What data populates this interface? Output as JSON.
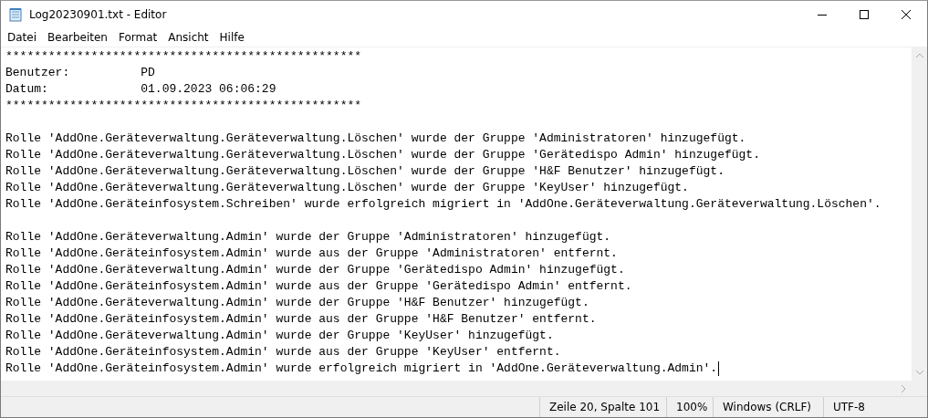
{
  "window": {
    "title": "Log20230901.txt - Editor"
  },
  "menu": [
    "Datei",
    "Bearbeiten",
    "Format",
    "Ansicht",
    "Hilfe"
  ],
  "editor": {
    "lines": [
      {
        "kind": "text",
        "text": "**************************************************"
      },
      {
        "kind": "text",
        "text": "Benutzer:          PD"
      },
      {
        "kind": "text",
        "text": "Datum:             01.09.2023 06:06:29"
      },
      {
        "kind": "text",
        "text": "**************************************************"
      },
      {
        "kind": "blank"
      },
      {
        "kind": "text",
        "text": "Rolle 'AddOne.Geräteverwaltung.Geräteverwaltung.Löschen' wurde der Gruppe 'Administratoren' hinzugefügt."
      },
      {
        "kind": "text",
        "text": "Rolle 'AddOne.Geräteverwaltung.Geräteverwaltung.Löschen' wurde der Gruppe 'Gerätedispo Admin' hinzugefügt."
      },
      {
        "kind": "text",
        "text": "Rolle 'AddOne.Geräteverwaltung.Geräteverwaltung.Löschen' wurde der Gruppe 'H&F Benutzer' hinzugefügt."
      },
      {
        "kind": "text",
        "text": "Rolle 'AddOne.Geräteverwaltung.Geräteverwaltung.Löschen' wurde der Gruppe 'KeyUser' hinzugefügt."
      },
      {
        "kind": "text",
        "text": "Rolle 'AddOne.Geräteinfosystem.Schreiben' wurde erfolgreich migriert in 'AddOne.Geräteverwaltung.Geräteverwaltung.Löschen'."
      },
      {
        "kind": "blank"
      },
      {
        "kind": "text",
        "text": "Rolle 'AddOne.Geräteverwaltung.Admin' wurde der Gruppe 'Administratoren' hinzugefügt."
      },
      {
        "kind": "text",
        "text": "Rolle 'AddOne.Geräteinfosystem.Admin' wurde aus der Gruppe 'Administratoren' entfernt."
      },
      {
        "kind": "text",
        "text": "Rolle 'AddOne.Geräteverwaltung.Admin' wurde der Gruppe 'Gerätedispo Admin' hinzugefügt."
      },
      {
        "kind": "text",
        "text": "Rolle 'AddOne.Geräteinfosystem.Admin' wurde aus der Gruppe 'Gerätedispo Admin' entfernt."
      },
      {
        "kind": "text",
        "text": "Rolle 'AddOne.Geräteverwaltung.Admin' wurde der Gruppe 'H&F Benutzer' hinzugefügt."
      },
      {
        "kind": "text",
        "text": "Rolle 'AddOne.Geräteinfosystem.Admin' wurde aus der Gruppe 'H&F Benutzer' entfernt."
      },
      {
        "kind": "text",
        "text": "Rolle 'AddOne.Geräteverwaltung.Admin' wurde der Gruppe 'KeyUser' hinzugefügt."
      },
      {
        "kind": "text",
        "text": "Rolle 'AddOne.Geräteinfosystem.Admin' wurde aus der Gruppe 'KeyUser' entfernt."
      },
      {
        "kind": "text",
        "text": "Rolle 'AddOne.Geräteinfosystem.Admin' wurde erfolgreich migriert in 'AddOne.Geräteverwaltung.Admin'.",
        "cursor": true
      }
    ]
  },
  "status_bar": [
    "Zeile 20, Spalte 101",
    "100%",
    "Windows (CRLF)",
    "UTF-8"
  ]
}
